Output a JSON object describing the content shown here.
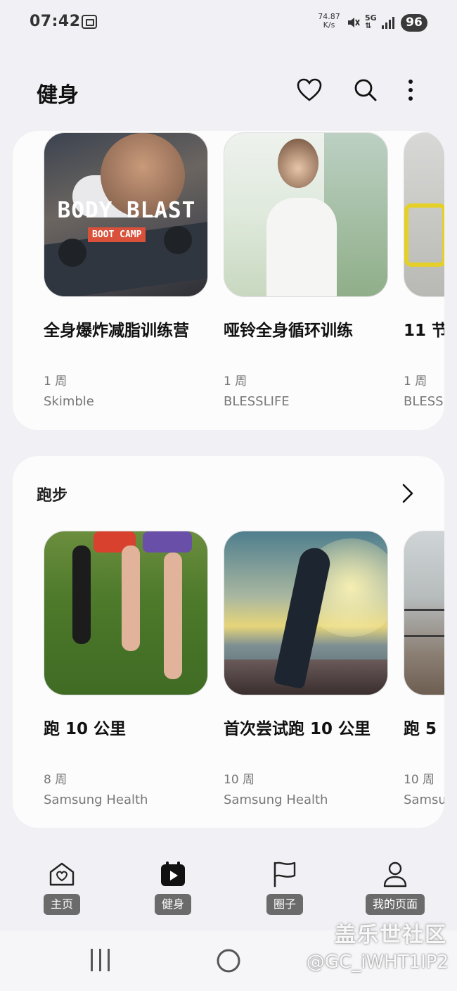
{
  "status_bar": {
    "time": "07:42",
    "speed_value": "74.87",
    "speed_unit": "K/s",
    "network": "5G",
    "battery": "96"
  },
  "header": {
    "title": "健身"
  },
  "featured": {
    "items": [
      {
        "title": "全身爆炸减脂训练营",
        "weeks": "1 周",
        "source": "Skimble",
        "image_text_main": "BODY BLAST",
        "image_text_sub": "BOOT CAMP"
      },
      {
        "title": "哑铃全身循环训练",
        "weeks": "1 周",
        "source": "BLESSLIFE"
      },
      {
        "title": "11 节",
        "weeks": "1 周",
        "source": "BLESS"
      }
    ]
  },
  "running": {
    "title": "跑步",
    "items": [
      {
        "title": "跑 10 公里",
        "weeks": "8 周",
        "source": "Samsung Health"
      },
      {
        "title": "首次尝试跑 10 公里",
        "weeks": "10 周",
        "source": "Samsung Health"
      },
      {
        "title": "跑 5",
        "weeks": "10 周",
        "source": "Samsu"
      }
    ]
  },
  "bottom_nav": {
    "items": [
      {
        "label": "主页",
        "icon": "home-heart-icon"
      },
      {
        "label": "健身",
        "icon": "calendar-play-icon"
      },
      {
        "label": "圈子",
        "icon": "flag-icon"
      },
      {
        "label": "我的页面",
        "icon": "person-icon"
      }
    ]
  },
  "watermark": {
    "line1": "盖乐世社区",
    "line2": "@GC_iWHT1IP2"
  }
}
